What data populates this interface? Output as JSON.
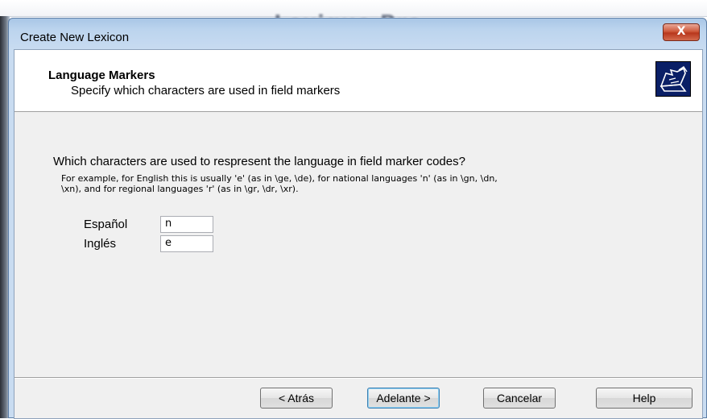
{
  "background_app": {
    "title": "Lexique Pro"
  },
  "window": {
    "title": "Create New Lexicon",
    "close_glyph": "X"
  },
  "header": {
    "title": "Language Markers",
    "subtitle": "Specify which characters are used in field markers",
    "icon": "wizard-folder-icon"
  },
  "body": {
    "question": "Which characters are used to respresent the language in field marker codes?",
    "example_line1": "For example, for English this is usually 'e' (as in \\ge, \\de), for national languages 'n' (as in \\gn, \\dn,",
    "example_line2": "\\xn), and for regional languages 'r' (as in \\gr, \\dr, \\xr)."
  },
  "languages": [
    {
      "label": "Español",
      "value": "n"
    },
    {
      "label": "Inglés",
      "value": "e"
    }
  ],
  "buttons": {
    "back": "< Atrás",
    "next": "Adelante >",
    "cancel": "Cancelar",
    "help": "Help"
  },
  "colors": {
    "titlebar": "#bcd4ee",
    "close_button": "#cf5a3c",
    "header_icon_bg": "#0a1f66"
  }
}
